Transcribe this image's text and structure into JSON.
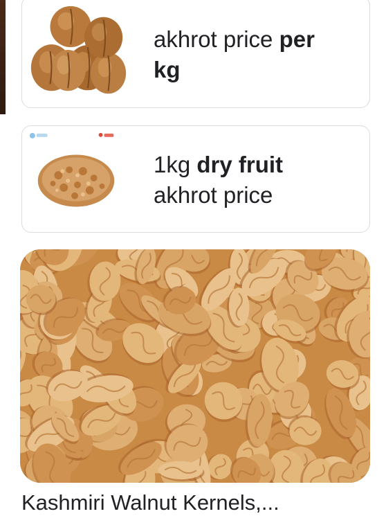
{
  "results": [
    {
      "title_parts": [
        {
          "text": "akhrot price ",
          "bold": false
        },
        {
          "text": "per",
          "bold": true
        },
        {
          "text": "kg",
          "bold": true
        }
      ],
      "thumbnail_icon": "whole-walnuts-thumbnail"
    },
    {
      "title_parts": [
        {
          "text": "1kg ",
          "bold": false
        },
        {
          "text": "dry fruit",
          "bold": true
        },
        {
          "text": "akhrot price",
          "bold": false
        }
      ],
      "thumbnail_icon": "walnut-kernels-thumbnail"
    }
  ],
  "image_result": {
    "title": "Kashmiri Walnut Kernels,...",
    "image_icon": "walnut-kernels-image"
  },
  "colors": {
    "text": "#202124",
    "card_border": "#dcdcdc",
    "walnut_light": "#e3b77a",
    "walnut_dark": "#a9652c"
  }
}
